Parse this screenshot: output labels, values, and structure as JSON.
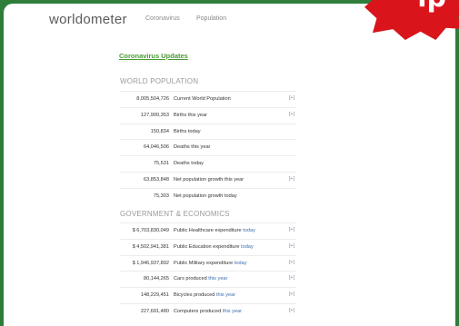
{
  "header": {
    "logo_left": "worldo",
    "logo_o": "",
    "logo_right": "meter",
    "nav": [
      "Coronavirus",
      "Population"
    ]
  },
  "updates_link": "Coronavirus Updates",
  "sections": [
    {
      "title": "WORLD POPULATION",
      "rows": [
        {
          "value": "8,005,504,726",
          "label": "Current World Population",
          "link": "",
          "chart": "[+]"
        },
        {
          "value": "127,900,353",
          "label": "Births this year",
          "link": "",
          "chart": "[+]"
        },
        {
          "value": "150,834",
          "label": "Births today",
          "link": "",
          "chart": ""
        },
        {
          "value": "64,046,506",
          "label": "Deaths this year",
          "link": "",
          "chart": ""
        },
        {
          "value": "75,531",
          "label": "Deaths today",
          "link": "",
          "chart": ""
        },
        {
          "value": "63,853,848",
          "label": "Net population growth this year",
          "link": "",
          "chart": "[+]"
        },
        {
          "value": "75,303",
          "label": "Net population growth today",
          "link": "",
          "chart": ""
        }
      ]
    },
    {
      "title": "GOVERNMENT & ECONOMICS",
      "rows": [
        {
          "value": "$ 6,703,830,049",
          "label": "Public Healthcare expenditure",
          "link": "today",
          "chart": "[+]"
        },
        {
          "value": "$ 4,502,941,381",
          "label": "Public Education expenditure",
          "link": "today",
          "chart": "[+]"
        },
        {
          "value": "$ 1,946,937,892",
          "label": "Public Military expenditure",
          "link": "today",
          "chart": "[+]"
        },
        {
          "value": "80,144,265",
          "label": "Cars produced",
          "link": "this year",
          "chart": "[+]"
        },
        {
          "value": "148,229,451",
          "label": "Bicycles produced",
          "link": "this year",
          "chart": "[+]"
        },
        {
          "value": "227,691,480",
          "label": "Computers produced",
          "link": "this year",
          "chart": "[+]"
        }
      ]
    }
  ]
}
